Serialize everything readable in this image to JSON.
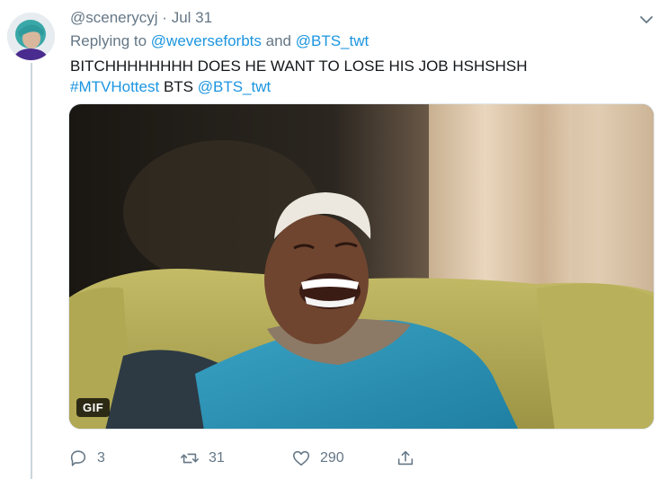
{
  "tweet": {
    "author_handle": "@scenerycyj",
    "separator": "·",
    "date": "Jul 31",
    "replying_to_prefix": "Replying to",
    "replying_to_user1": "@weverseforbts",
    "replying_and": "and",
    "replying_to_user2": "@BTS_twt",
    "text_line1": "BITCHHHHHHHH DOES HE WANT TO LOSE HIS JOB HSHSHSH",
    "hashtag": "#MTVHottest",
    "text_word": "BTS",
    "mention": "@BTS_twt",
    "media_badge": "GIF",
    "reply_count": "3",
    "retweet_count": "31",
    "like_count": "290"
  },
  "icons": {
    "menu": "chevron-down-icon",
    "reply": "reply-icon",
    "retweet": "retweet-icon",
    "like": "heart-icon",
    "share": "share-icon"
  },
  "colors": {
    "link": "#1b95e0",
    "muted": "#657786",
    "text": "#14171a"
  }
}
